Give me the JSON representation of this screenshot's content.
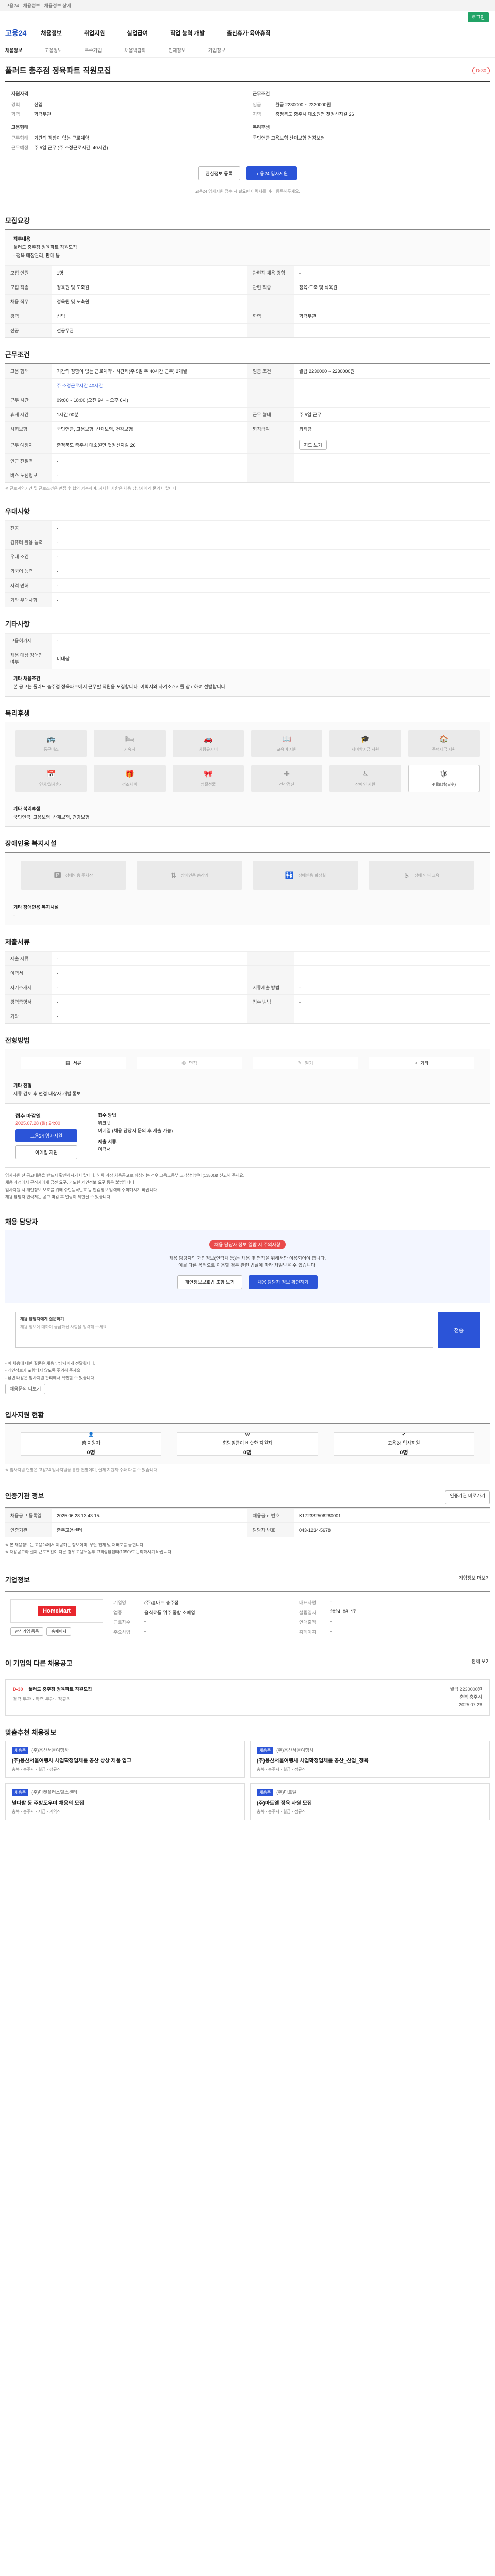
{
  "topbar": {
    "text": "고용24 · 채용정보 · 채용정보 상세"
  },
  "greenbar": {
    "label": "로그인"
  },
  "header": {
    "logo": "고용24",
    "nav": [
      "채용정보",
      "취업지원",
      "실업급여",
      "직업 능력 개발",
      "출산휴가·육아휴직"
    ]
  },
  "subnav": [
    "채용정보",
    "고용정보",
    "우수기업",
    "채용박람회",
    "인재정보",
    "기업정보"
  ],
  "job": {
    "title": "풀러드 충주점 정육파트 직원모집",
    "dday": "D-30",
    "left_heading": "지원자격",
    "left": [
      {
        "k": "경력",
        "v": "신입"
      },
      {
        "k": "학력",
        "v": "학력무관"
      }
    ],
    "right_heading": "근무조건",
    "right": [
      {
        "k": "임금",
        "v": "월급 2230000 ~ 2230000원"
      },
      {
        "k": "지역",
        "v": "충청북도 충주시 대소원면 첫정신지길 26"
      }
    ],
    "left2_heading": "고용형태",
    "left2": [
      {
        "k": "근무형태",
        "v": "기간의 정함이 없는 근로계약"
      },
      {
        "k": "근무예정",
        "v": "주 5일 근무 (주 소정근로시간: 40시간)"
      }
    ],
    "right2_heading": "복리후생",
    "right2": [
      {
        "k": "",
        "v": "국민연금 고용보험 산재보험 건강보험"
      }
    ],
    "btn_interest": "관심정보 등록",
    "btn_apply": "고용24 입사지원",
    "notice": "고용24 입사지원 접수 시 필요한 이력서를 미리 등록해두세요."
  },
  "section_titles": {
    "recruit": "모집요강",
    "work": "근무조건",
    "pref": "우대사항",
    "other": "기타사항",
    "welfare": "복리후생",
    "disability": "장애인용 복지시설",
    "docs": "제출서류",
    "method": "전형방법",
    "contact": "채용 담당자",
    "apply_status": "입사지원 현황",
    "info": "인증기관 정보",
    "company": "기업정보",
    "related": "이 기업의 다른 채용공고",
    "similar": "맞춤추천 채용정보"
  },
  "recruit": {
    "duty_label": "직무내용",
    "duty_lines": [
      "풀러드 충주점 정육파트 직원모집",
      "- 정육 매장관리, 판매 등"
    ],
    "rows": [
      [
        "모집 인원",
        "1명",
        "관련직 채용 경험",
        "-"
      ],
      [
        "모집 직종",
        "정육원 및 도축원",
        "관련 직종",
        "정육·도축 및 식육원"
      ],
      [
        "채용 직무",
        "정육원 및 도축원",
        "",
        ""
      ],
      [
        "경력",
        "신입",
        "학력",
        "학력무관"
      ],
      [
        "전공",
        "전공무관",
        "",
        ""
      ]
    ]
  },
  "work": {
    "rows": [
      [
        "고용 형태",
        "기간의 정함이 없는 근로계약 · 시간제(주 5일 주 40시간 근무) 2개월",
        "임금 조건",
        "월급 2230000 ~ 2230000원"
      ],
      [
        "",
        "주 소정근로시간 40시간",
        "",
        ""
      ],
      [
        "근무 시간",
        "09:00 ~ 18:00 (오전 9시 ~ 오후 6시)",
        "",
        ""
      ],
      [
        "휴게 시간",
        "1시간 00분",
        "근무 형태",
        "주 5일 근무"
      ],
      [
        "사회보험",
        "국민연금, 고용보험, 산재보험, 건강보험",
        "퇴직급여",
        "퇴직금"
      ],
      [
        "근무 예정지",
        "충청북도 충주시 대소원면 첫정신지길 26",
        "",
        ""
      ],
      [
        "인근 전철역",
        "-",
        "",
        ""
      ],
      [
        "버스 노선정보",
        "-",
        "",
        ""
      ]
    ],
    "map_btn": "지도 보기",
    "note": "※ 근로계약기간 및 근로조건은 면접 후 협의 가능하며, 자세한 사항은 채용 담당자에게 문의 바랍니다."
  },
  "pref": {
    "rows": [
      [
        "전공",
        "-"
      ],
      [
        "컴퓨터 활용 능력",
        "-"
      ],
      [
        "우대 조건",
        "-"
      ],
      [
        "외국어 능력",
        "-"
      ],
      [
        "자격 면허",
        "-"
      ],
      [
        "기타 우대사항",
        "-"
      ]
    ]
  },
  "other": {
    "rows": [
      [
        "고용허가제",
        "-"
      ],
      [
        "채용 대상 장애인 여부",
        "비대상"
      ]
    ],
    "extra_label": "기타 채용조건",
    "extra": "본 공고는 풀러드 충주점 정육파트에서 근무할 직원을 모집합니다. 이력서와 자기소개서를 참고하여 선발합니다."
  },
  "welfare": {
    "items": [
      {
        "name": "통근버스",
        "on": false
      },
      {
        "name": "기숙사",
        "on": false
      },
      {
        "name": "차량유지비",
        "on": false
      },
      {
        "name": "교육비 지원",
        "on": false
      },
      {
        "name": "자녀학자금 지원",
        "on": false
      },
      {
        "name": "주택자금 지원",
        "on": false
      },
      {
        "name": "연차/월차휴가",
        "on": false
      },
      {
        "name": "경조사비",
        "on": false
      },
      {
        "name": "명절선물",
        "on": false
      },
      {
        "name": "건강검진",
        "on": false
      },
      {
        "name": "장애인 지원",
        "on": false
      },
      {
        "name": "4대보험(필수)",
        "on": true
      }
    ],
    "extra_label": "기타 복리후생",
    "extra": "국민연금, 고용보험, 산재보험, 건강보험"
  },
  "disability": {
    "items": [
      "장애인용 주차장",
      "장애인용 승강기",
      "장애인용 화장실",
      "장애 인식 교육"
    ],
    "extra_label": "기타 장애인용 복지시설",
    "extra": "-"
  },
  "docs": {
    "rows": [
      [
        "제출 서류",
        "-",
        "",
        ""
      ],
      [
        "이력서",
        "-",
        "",
        ""
      ],
      [
        "자기소개서",
        "-",
        "서류제출 방법",
        "-"
      ],
      [
        "경력증명서",
        "-",
        "접수 방법",
        "-"
      ],
      [
        "기타",
        "-",
        "",
        ""
      ]
    ]
  },
  "method": {
    "items": [
      {
        "name": "서류",
        "on": true
      },
      {
        "name": "면접",
        "on": false
      },
      {
        "name": "필기",
        "on": false
      },
      {
        "name": "기타",
        "on": true
      }
    ],
    "extra_label": "기타 전형",
    "extra": "서류 검토 후 면접 대상자 개별 통보"
  },
  "deadline": {
    "label": "접수 마감일",
    "date": "2025.07.28 (월) 24:00",
    "apply_btn": "고용24 입사지원",
    "email_btn": "이메일 지원",
    "method_label": "접수 방법",
    "method_lines": [
      "워크넷",
      "이메일 (채용 담당자 문의 후 제출 가능)"
    ],
    "doc_label": "제출 서류",
    "doc": "이력서"
  },
  "bullets": [
    "입사지원 전 공고내용을 반드시 확인하시기 바랍니다. 허위·과장 채용공고로 의심되는 경우 고용노동부 고객상담센터(1350)로 신고해 주세요.",
    "채용 과정에서 구직자에게 금전 요구, 과도한 개인정보 요구 등은 불법입니다.",
    "입사지원 시 개인정보 보호를 위해 주민등록번호 등 민감정보 입력에 주의하시기 바랍니다.",
    "채용 담당자 연락처는 공고 마감 후 열람이 제한될 수 있습니다."
  ],
  "contact": {
    "pill": "채용 담당자 정보 열람 시 주의사항",
    "lines": [
      "채용 담당자의 개인정보(연락처 등)는 채용 및 면접을 위해서만 이용되어야 합니다.",
      "이를 다른 목적으로 이용할 경우 관련 법률에 따라 처벌받을 수 있습니다."
    ],
    "btn_a": "개인정보보호법 조항 보기",
    "btn_b": "채용 담당자 정보 확인하기"
  },
  "inquiry": {
    "label": "채용 담당자에게 질문하기",
    "placeholder": "채용 정보에 대하여 궁금하신 사항을 입력해 주세요.",
    "send": "전송",
    "notes": [
      "- 이 채용에 대한 질문은 채용 담당자에게 전달됩니다.",
      "- 개인정보가 포함되지 않도록 주의해 주세요.",
      "- 답변 내용은 입사지원 관리에서 확인할 수 있습니다."
    ],
    "more": "채용문의 더보기"
  },
  "apply_status": {
    "stats": [
      {
        "label": "총 지원자",
        "n": "0명"
      },
      {
        "label": "희망임금이 비슷한 지원자",
        "n": "0명"
      },
      {
        "label": "고용24 입사지원",
        "n": "0명"
      }
    ],
    "note": "※ 입사지원 현황은 고용24 입사지원을 통한 현황이며, 실제 지원자 수와 다를 수 있습니다."
  },
  "info": {
    "btn": "인증기관 바로가기",
    "rows": [
      [
        "채용공고 등록일",
        "2025.06.28 13:43:15",
        "채용공고 번호",
        "K172332506280001"
      ],
      [
        "인증기관",
        "충주고용센터",
        "담당자 번호",
        "043-1234-5678"
      ]
    ],
    "notes": [
      "※ 본 채용정보는 고용24에서 제공하는 정보이며, 무단 전재 및 재배포를 금합니다.",
      "※ 채용공고와 실제 근로조건이 다른 경우 고용노동부 고객상담센터(1350)로 문의하시기 바랍니다."
    ]
  },
  "company": {
    "logo_text": "HomeMart",
    "more": "기업정보 더보기",
    "kvs": [
      [
        "기업명",
        "(주)홈마트 충주점",
        "대표자명",
        "-"
      ],
      [
        "업종",
        "음식료품 위주 종합 소매업",
        "설립일자",
        "2024. 06. 17"
      ],
      [
        "근로자수",
        "-",
        "연매출액",
        "-"
      ],
      [
        "주요사업",
        "-",
        "홈페이지",
        "-"
      ]
    ],
    "btn_a": "관심기업 등록",
    "btn_b": "홈페이지"
  },
  "related": {
    "more": "전체 보기",
    "card": {
      "badge": "D-30",
      "title": "풀러드 충주점 정육파트 직원모집",
      "sub": "경력 무관 · 학력 무관 · 정규직",
      "right": [
        "월급 2230000원",
        "충북 충주시",
        "2025.07.28"
      ]
    }
  },
  "similar": {
    "cards": [
      {
        "tag": "채용중",
        "co": "(주)용산서울여행사",
        "title": "(주)용산서울여행사 사업확정업체를 공산 상상 제품 업그",
        "meta": "충북 · 충주시 · 월급 · 정규직"
      },
      {
        "tag": "채용중",
        "co": "(주)용산서울여행사",
        "title": "(주)용산서울여행사 사업확정업체를 공산_산업_정육",
        "meta": "충북 · 충주시 · 월급 · 정규직"
      },
      {
        "tag": "채용중",
        "co": "(주)마켓플러스헬스센터",
        "title": "널다발 동 주방도우미 채용의 모집",
        "meta": "충북 · 충주시 · 시급 · 계약직"
      },
      {
        "tag": "채용중",
        "co": "(주)마트엘",
        "title": "(주)마트엘 정육 사원 모집",
        "meta": "충북 · 충주시 · 월급 · 정규직"
      }
    ]
  }
}
